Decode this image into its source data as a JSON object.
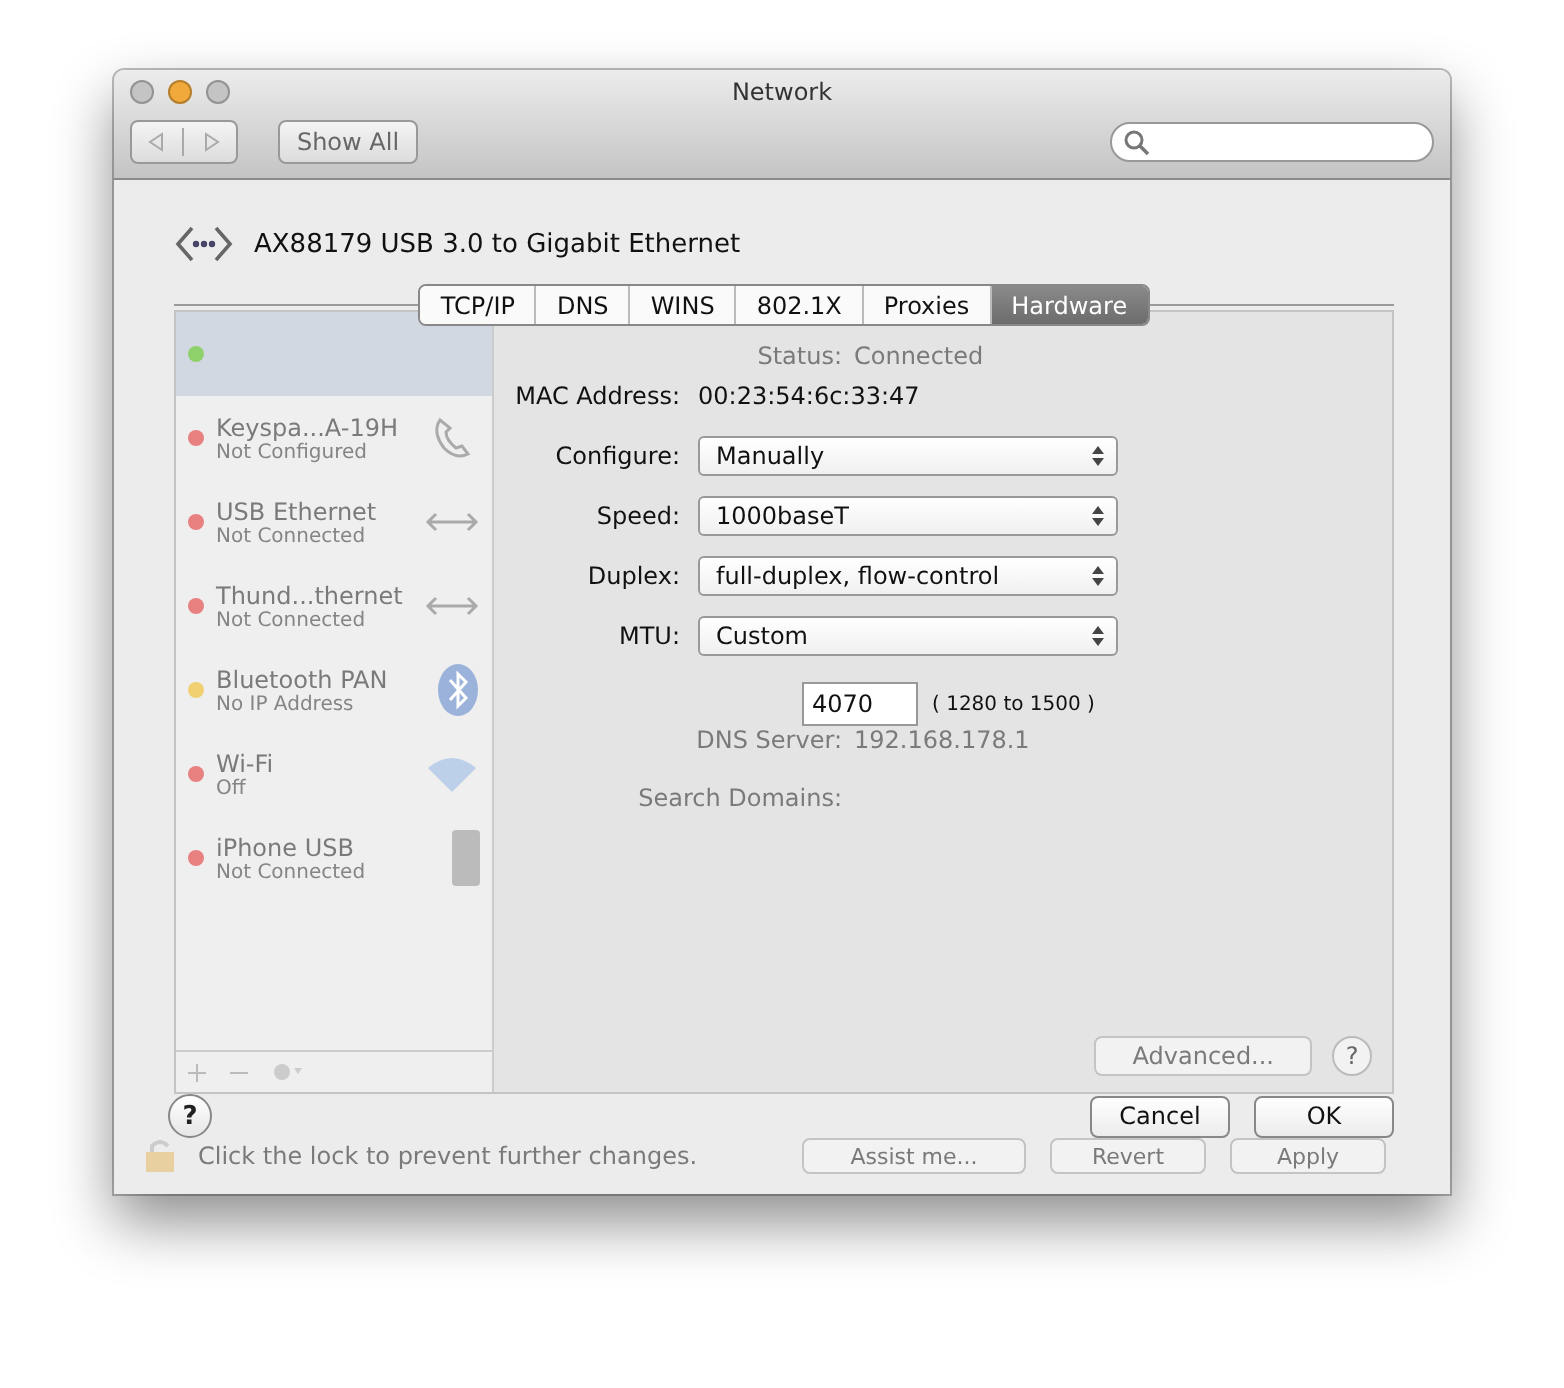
{
  "window": {
    "title": "Network",
    "traffic_lights": [
      {
        "color": "#c4c4c4"
      },
      {
        "color": "#f2a93b"
      },
      {
        "color": "#c4c4c4"
      }
    ]
  },
  "toolbar": {
    "show_all": "Show All"
  },
  "background": {
    "services": [
      {
        "selected": true,
        "color": "#8ed16a"
      },
      {
        "name": "Keyspa...A-19H",
        "status": "Not Configured",
        "color": "#e88080",
        "selected": false,
        "kind": "phone"
      },
      {
        "name": "USB Ethernet",
        "status": "Not Connected",
        "color": "#e88080",
        "selected": false,
        "kind": "ethernet"
      },
      {
        "name": "Thund...thernet",
        "status": "Not Connected",
        "color": "#e88080",
        "selected": false,
        "kind": "ethernet"
      },
      {
        "name": "Bluetooth PAN",
        "status": "No IP Address",
        "color": "#f0d070",
        "selected": false,
        "kind": "bluetooth"
      },
      {
        "name": "Wi-Fi",
        "status": "Off",
        "color": "#e88080",
        "selected": false,
        "kind": "wifi"
      },
      {
        "name": "iPhone USB",
        "status": "Not Connected",
        "color": "#e88080",
        "selected": false,
        "kind": "iphone"
      }
    ],
    "status_label": "Status:",
    "status_value": "Connected",
    "details": [
      {
        "label": "DNS Server:",
        "value": "192.168.178.1"
      },
      {
        "label": "Search Domains:"
      }
    ],
    "advanced": "Advanced...",
    "help": "?",
    "lock_text": "Click the lock to prevent further changes.",
    "buttons": [
      "Assist me...",
      "Revert",
      "Apply"
    ]
  },
  "sheet": {
    "title": "AX88179 USB 3.0 to Gigabit Ethernet",
    "tabs": [
      {
        "label": "TCP/IP",
        "selected": false
      },
      {
        "label": "DNS",
        "selected": false
      },
      {
        "label": "WINS",
        "selected": false
      },
      {
        "label": "802.1X",
        "selected": false
      },
      {
        "label": "Proxies",
        "selected": false
      },
      {
        "label": "Hardware",
        "selected": true
      }
    ],
    "mac_label": "MAC Address:",
    "mac_value": "00:23:54:6c:33:47",
    "fields": [
      {
        "label": "Configure:",
        "value": "Manually"
      },
      {
        "label": "Speed:",
        "value": "1000baseT"
      },
      {
        "label": "Duplex:",
        "value": "full-duplex, flow-control"
      },
      {
        "label": "MTU:",
        "value": "Custom"
      }
    ],
    "mtu_value": "4070",
    "mtu_range": "( 1280 to 1500 )",
    "help": "?",
    "cancel": "Cancel",
    "ok": "OK"
  }
}
